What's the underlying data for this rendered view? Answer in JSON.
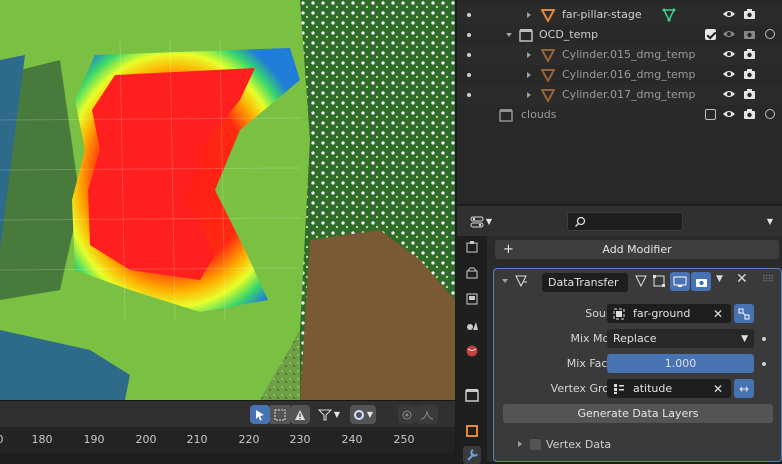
{
  "timeline": {
    "ticks": [
      "0",
      "180",
      "190",
      "200",
      "210",
      "220",
      "230",
      "240",
      "250"
    ]
  },
  "outliner": {
    "rows": [
      {
        "label": "far-pillar-stage",
        "type": "object",
        "icon": "mesh-triangle-icon"
      },
      {
        "label": "OCD_temp",
        "type": "collection"
      },
      {
        "label": "Cylinder.015_dmg_temp",
        "type": "object"
      },
      {
        "label": "Cylinder.016_dmg_temp",
        "type": "object"
      },
      {
        "label": "Cylinder.017_dmg_temp",
        "type": "object"
      },
      {
        "label": "clouds",
        "type": "collection"
      }
    ]
  },
  "properties": {
    "add_modifier_label": "Add Modifier",
    "modifier": {
      "name": "DataTransfer",
      "source_label": "Source",
      "source_value": "far-ground",
      "mix_mode_label": "Mix Mode",
      "mix_mode_value": "Replace",
      "mix_factor_label": "Mix Factor",
      "mix_factor_value": "1.000",
      "vertex_group_label": "Vertex Group",
      "vertex_group_value": "atitude",
      "generate_label": "Generate Data Layers",
      "vertex_data_label": "Vertex Data"
    }
  },
  "colors": {
    "accent": "#4772b3",
    "object_orange": "#e08a3c",
    "mesh_green": "#3fd08a"
  }
}
